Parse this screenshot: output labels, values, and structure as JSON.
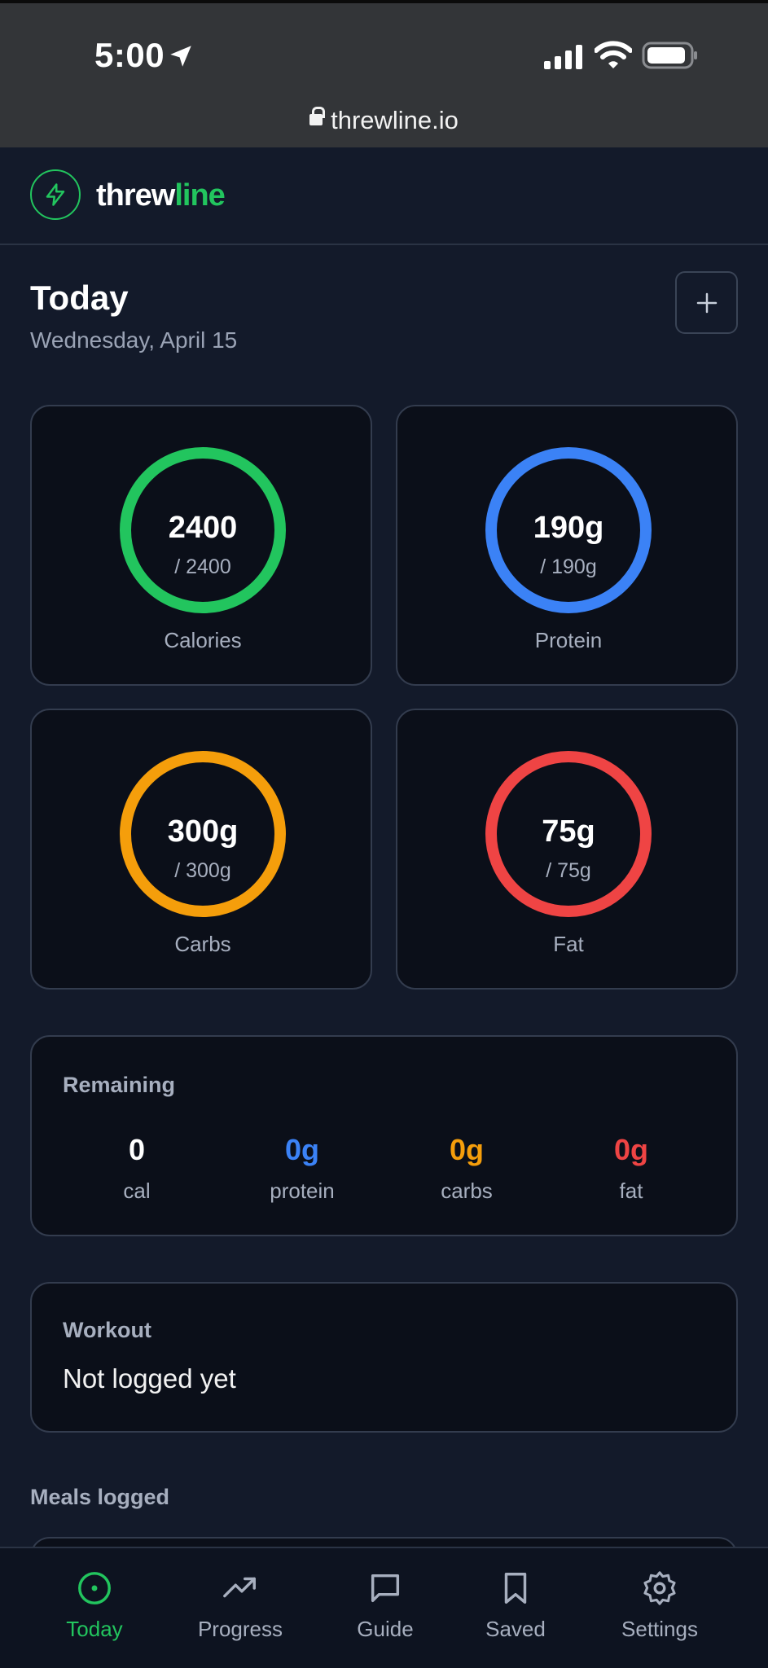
{
  "status_bar": {
    "time": "5:00"
  },
  "url_bar": {
    "domain": "threwline.io"
  },
  "brand": {
    "part1": "threw",
    "part2": "line",
    "accent_color": "#22c55e"
  },
  "page": {
    "title": "Today",
    "date": "Wednesday, April 15"
  },
  "macros": [
    {
      "label": "Calories",
      "value": "2400",
      "goal": "/ 2400",
      "color": "#22c55e",
      "progress": 1.0
    },
    {
      "label": "Protein",
      "value": "190g",
      "goal": "/ 190g",
      "color": "#3b82f6",
      "progress": 1.0
    },
    {
      "label": "Carbs",
      "value": "300g",
      "goal": "/ 300g",
      "color": "#f59e0b",
      "progress": 1.0
    },
    {
      "label": "Fat",
      "value": "75g",
      "goal": "/ 75g",
      "color": "#ef4444",
      "progress": 1.0
    }
  ],
  "remaining": {
    "title": "Remaining",
    "items": [
      {
        "value": "0",
        "unit": "cal",
        "color": "#ffffff"
      },
      {
        "value": "0g",
        "unit": "protein",
        "color": "#3b82f6"
      },
      {
        "value": "0g",
        "unit": "carbs",
        "color": "#f59e0b"
      },
      {
        "value": "0g",
        "unit": "fat",
        "color": "#ef4444"
      }
    ]
  },
  "workout": {
    "title": "Workout",
    "status": "Not logged yet"
  },
  "meals": {
    "title": "Meals logged"
  },
  "nav": [
    {
      "label": "Today",
      "icon": "target-icon",
      "active": true
    },
    {
      "label": "Progress",
      "icon": "trending-up-icon",
      "active": false
    },
    {
      "label": "Guide",
      "icon": "chat-bubble-icon",
      "active": false
    },
    {
      "label": "Saved",
      "icon": "bookmark-icon",
      "active": false
    },
    {
      "label": "Settings",
      "icon": "gear-icon",
      "active": false
    }
  ]
}
